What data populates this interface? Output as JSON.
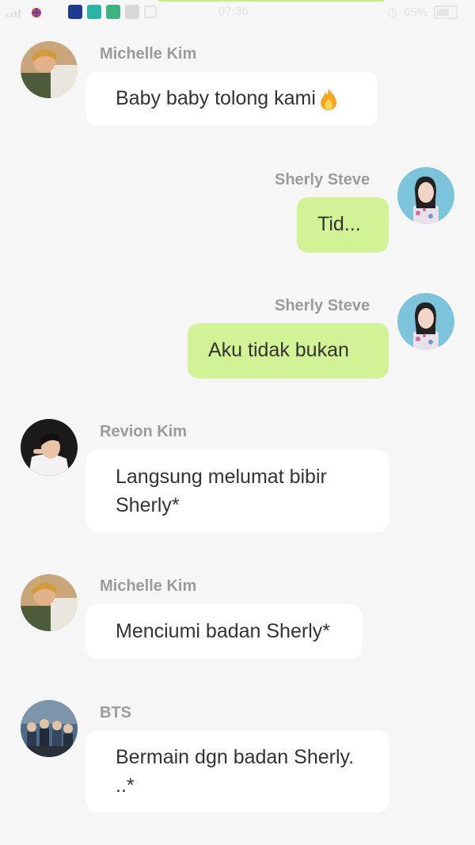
{
  "status_bar": {
    "time": "07:36",
    "battery": "65%"
  },
  "messages": [
    {
      "sender": "Michelle Kim",
      "text": "Baby baby tolong kami",
      "emoji": "fire-emoji",
      "side": "left",
      "avatar": "michelle-avatar"
    },
    {
      "sender": "Sherly Steve",
      "text": "Tid...",
      "side": "right",
      "avatar": "sherly-avatar"
    },
    {
      "sender": "Sherly Steve",
      "text": "Aku tidak bukan",
      "side": "right",
      "avatar": "sherly-avatar"
    },
    {
      "sender": "Revion Kim",
      "text": "Langsung melumat bibir Sherly*",
      "side": "left",
      "avatar": "revion-avatar"
    },
    {
      "sender": "Michelle Kim",
      "text": "Menciumi badan Sherly*",
      "side": "left",
      "avatar": "michelle-avatar"
    },
    {
      "sender": "BTS",
      "text": "Bermain dgn badan Sherly. ..*",
      "side": "left",
      "avatar": "bts-avatar"
    }
  ],
  "colors": {
    "background": "#f6f6f6",
    "left_bubble": "#ffffff",
    "right_bubble": "#d2f296",
    "name": "#9b9b9b",
    "text": "#333333"
  }
}
